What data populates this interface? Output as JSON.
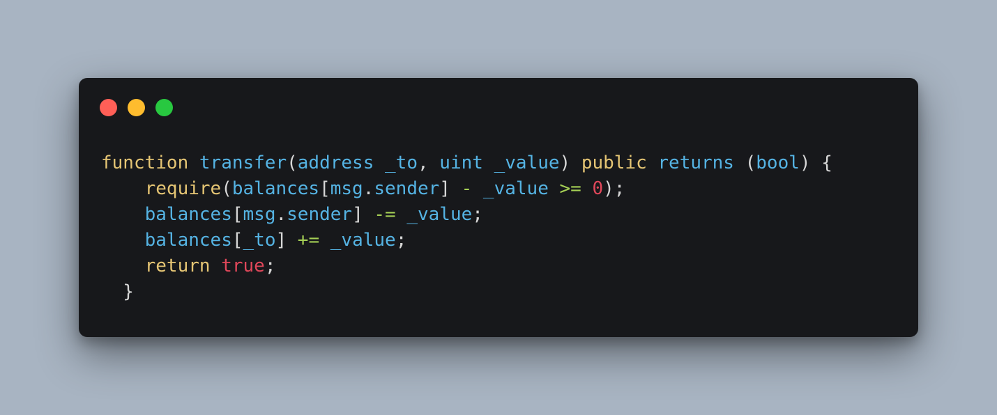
{
  "colors": {
    "background": "#a8b4c2",
    "window": "#17181b",
    "dot_close": "#ff5f57",
    "dot_minimize": "#febc2e",
    "dot_zoom": "#28c840",
    "keyword": "#e5c574",
    "identifier": "#55b3e3",
    "operator": "#a6d055",
    "literal": "#e0475a",
    "punctuation": "#d6d6d6"
  },
  "window_controls": [
    {
      "name": "close",
      "icon": "red-circle"
    },
    {
      "name": "minimize",
      "icon": "yellow-circle"
    },
    {
      "name": "zoom",
      "icon": "green-circle"
    }
  ],
  "code": {
    "lines": [
      [
        {
          "t": "function",
          "k": "kw"
        },
        {
          "t": " ",
          "k": "pun"
        },
        {
          "t": "transfer",
          "k": "id"
        },
        {
          "t": "(",
          "k": "pun"
        },
        {
          "t": "address",
          "k": "id"
        },
        {
          "t": " ",
          "k": "pun"
        },
        {
          "t": "_to",
          "k": "id"
        },
        {
          "t": ", ",
          "k": "pun"
        },
        {
          "t": "uint",
          "k": "id"
        },
        {
          "t": " ",
          "k": "pun"
        },
        {
          "t": "_value",
          "k": "id"
        },
        {
          "t": ") ",
          "k": "pun"
        },
        {
          "t": "public",
          "k": "kw"
        },
        {
          "t": " ",
          "k": "pun"
        },
        {
          "t": "returns",
          "k": "id"
        },
        {
          "t": " (",
          "k": "pun"
        },
        {
          "t": "bool",
          "k": "id"
        },
        {
          "t": ") {",
          "k": "pun"
        }
      ],
      [
        {
          "t": "    ",
          "k": "pun"
        },
        {
          "t": "require",
          "k": "kw"
        },
        {
          "t": "(",
          "k": "pun"
        },
        {
          "t": "balances",
          "k": "id"
        },
        {
          "t": "[",
          "k": "pun"
        },
        {
          "t": "msg",
          "k": "id"
        },
        {
          "t": ".",
          "k": "pun"
        },
        {
          "t": "sender",
          "k": "id"
        },
        {
          "t": "] ",
          "k": "pun"
        },
        {
          "t": "-",
          "k": "op"
        },
        {
          "t": " ",
          "k": "pun"
        },
        {
          "t": "_value",
          "k": "id"
        },
        {
          "t": " ",
          "k": "pun"
        },
        {
          "t": ">=",
          "k": "op"
        },
        {
          "t": " ",
          "k": "pun"
        },
        {
          "t": "0",
          "k": "lit"
        },
        {
          "t": ");",
          "k": "pun"
        }
      ],
      [
        {
          "t": "    ",
          "k": "pun"
        },
        {
          "t": "balances",
          "k": "id"
        },
        {
          "t": "[",
          "k": "pun"
        },
        {
          "t": "msg",
          "k": "id"
        },
        {
          "t": ".",
          "k": "pun"
        },
        {
          "t": "sender",
          "k": "id"
        },
        {
          "t": "] ",
          "k": "pun"
        },
        {
          "t": "-=",
          "k": "op"
        },
        {
          "t": " ",
          "k": "pun"
        },
        {
          "t": "_value",
          "k": "id"
        },
        {
          "t": ";",
          "k": "pun"
        }
      ],
      [
        {
          "t": "    ",
          "k": "pun"
        },
        {
          "t": "balances",
          "k": "id"
        },
        {
          "t": "[",
          "k": "pun"
        },
        {
          "t": "_to",
          "k": "id"
        },
        {
          "t": "] ",
          "k": "pun"
        },
        {
          "t": "+=",
          "k": "op"
        },
        {
          "t": " ",
          "k": "pun"
        },
        {
          "t": "_value",
          "k": "id"
        },
        {
          "t": ";",
          "k": "pun"
        }
      ],
      [
        {
          "t": "    ",
          "k": "pun"
        },
        {
          "t": "return",
          "k": "kw"
        },
        {
          "t": " ",
          "k": "pun"
        },
        {
          "t": "true",
          "k": "lit"
        },
        {
          "t": ";",
          "k": "pun"
        }
      ],
      [
        {
          "t": "  }",
          "k": "pun"
        }
      ]
    ]
  }
}
